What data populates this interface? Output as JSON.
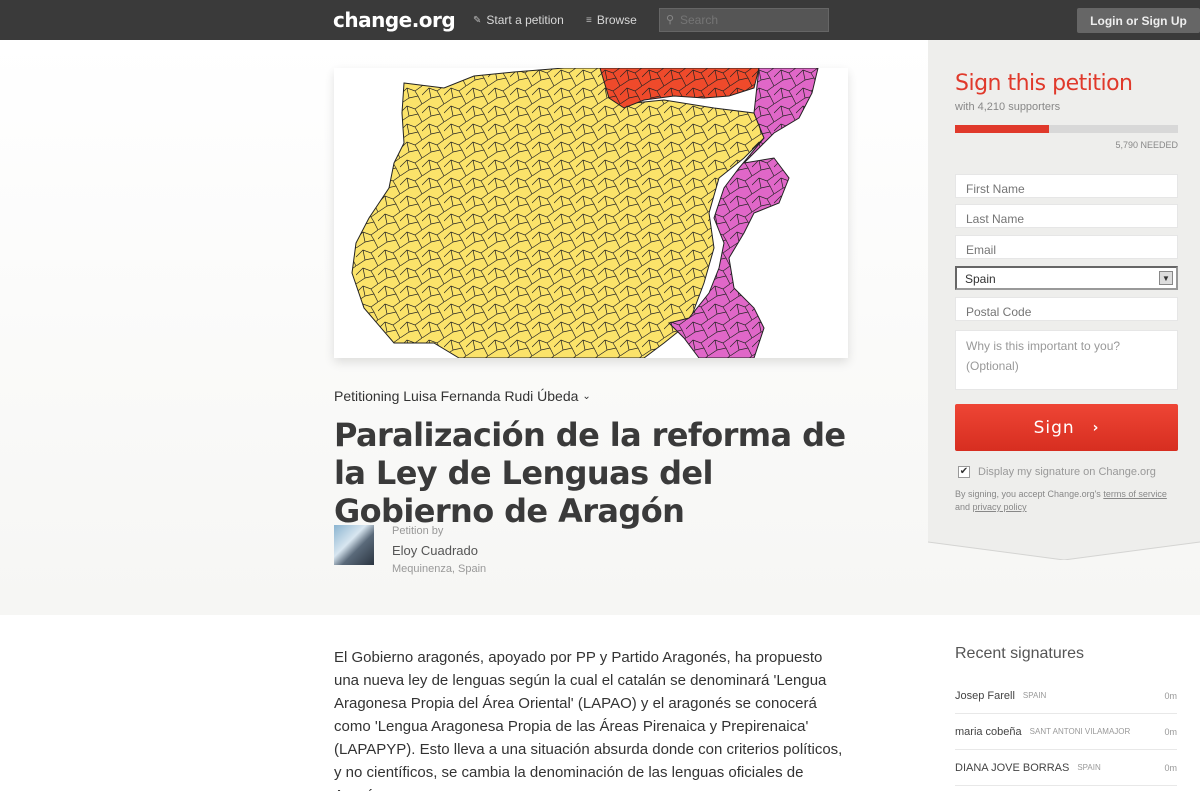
{
  "nav": {
    "logo": "change.org",
    "start_petition": "Start a petition",
    "browse": "Browse",
    "search_placeholder": "Search",
    "login": "Login or Sign Up"
  },
  "petition": {
    "petitioning": "Petitioning Luisa Fernanda Rudi Úbeda",
    "title": "Paralización de la reforma de la Ley de Lenguas del Gobierno de Aragón",
    "petition_by_label": "Petition by",
    "author": "Eloy Cuadrado",
    "location": "Mequinenza, Spain",
    "body": "El Gobierno aragonés, apoyado por PP y Partido Aragonés, ha propuesto una nueva ley de lenguas según la cual el catalán se denominará 'Lengua Aragonesa Propia del Área Oriental' (LAPAO) y el aragonés se conocerá como 'Lengua Aragonesa Propia de las Áreas Pirenaica y Prepirenaica' (LAPAPYP). Esto lleva a una situación absurda donde con criterios políticos, y no científicos, se cambia la denominación de las lenguas oficiales de Aragón"
  },
  "sign": {
    "title": "Sign this petition",
    "supporters": "with 4,210 supporters",
    "progress_fraction": 0.42,
    "needed": "5,790 NEEDED",
    "first_name": "First Name",
    "last_name": "Last Name",
    "email": "Email",
    "country": "Spain",
    "postal_code": "Postal Code",
    "why": "Why is this important to you? (Optional)",
    "button": "Sign",
    "display_signature": "Display my signature on Change.org",
    "terms_prefix": "By signing, you accept Change.org's",
    "terms_link": "terms of service",
    "terms_and": "and",
    "privacy_link": "privacy policy"
  },
  "recent": {
    "title": "Recent signatures",
    "items": [
      {
        "name": "Josep Farell",
        "location": "SPAIN",
        "time": "0m"
      },
      {
        "name": "maria cobeña",
        "location": "SANT ANTONI VILAMAJOR",
        "time": "0m"
      },
      {
        "name": "DIANA JOVE BORRAS",
        "location": "SPAIN",
        "time": "0m"
      }
    ]
  },
  "colors": {
    "accent": "#e0392b",
    "nav_bg": "#3a3a3a",
    "map_yellow": "#fbe36a",
    "map_red": "#ef4a2b",
    "map_magenta": "#e067c8"
  }
}
